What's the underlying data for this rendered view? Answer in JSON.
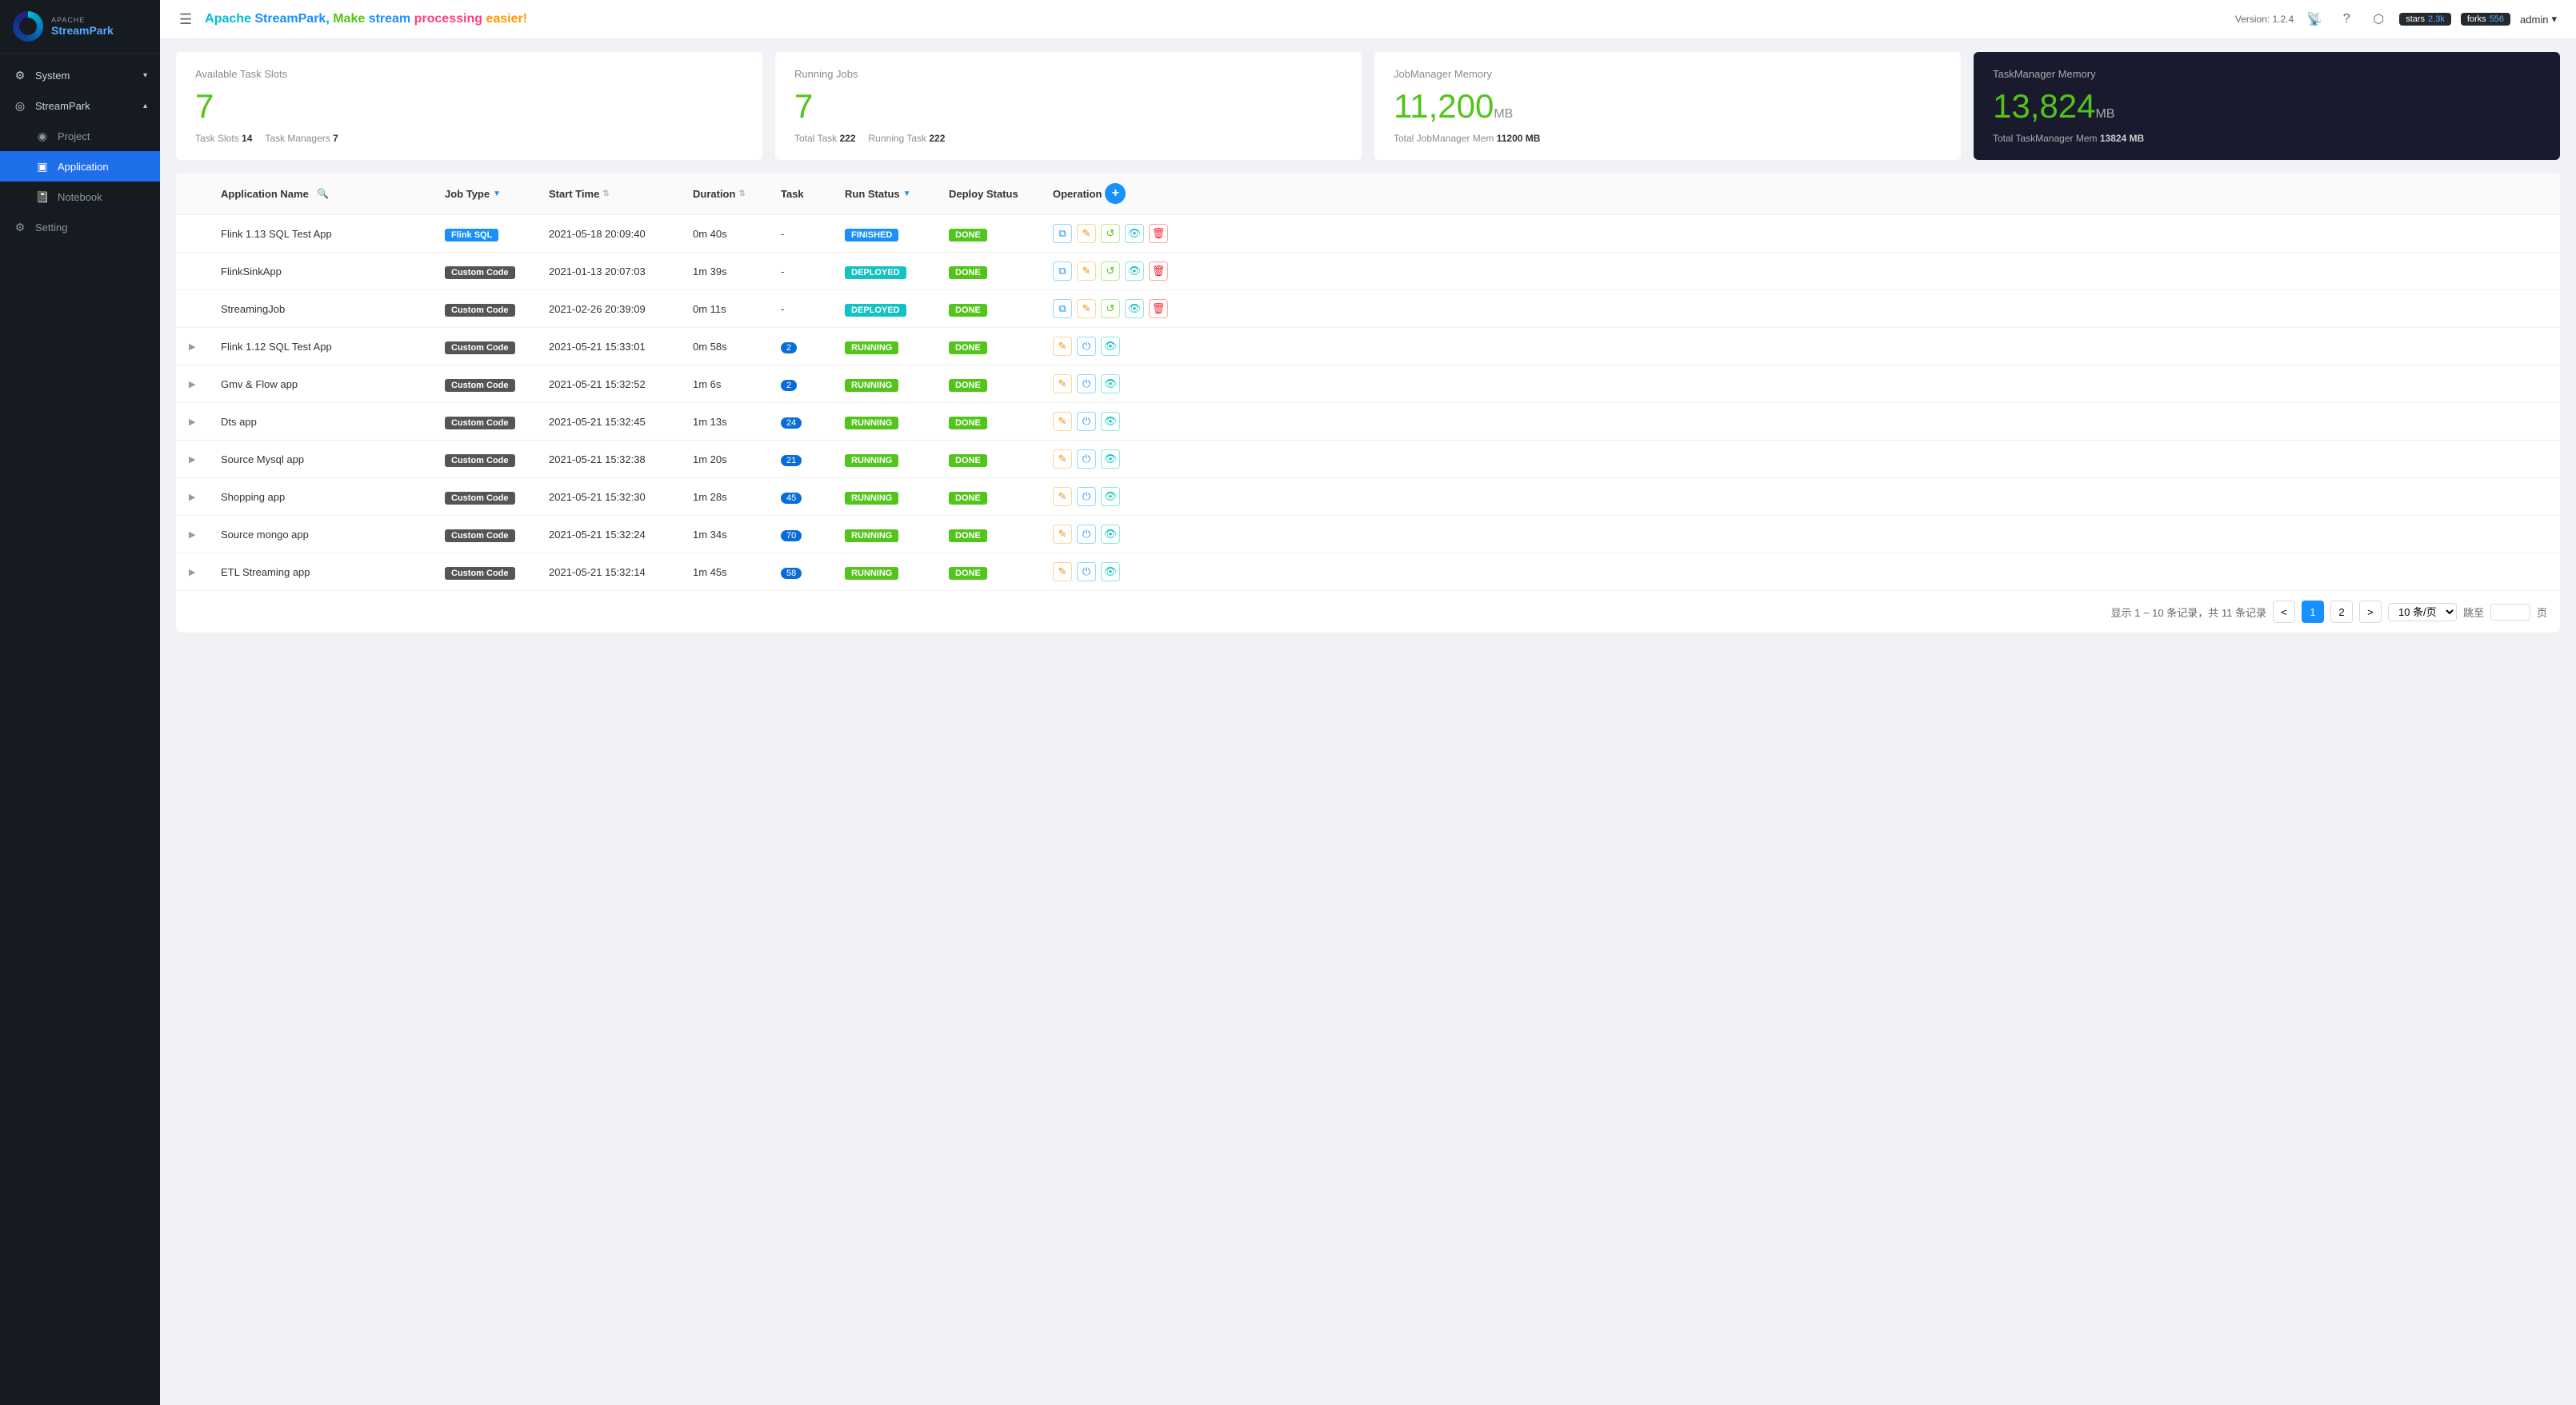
{
  "sidebar": {
    "logo": {
      "apache": "APACHE",
      "streampark": "StreamPark"
    },
    "nav": [
      {
        "id": "system",
        "label": "System",
        "icon": "⚙",
        "hasChevron": true,
        "active": false
      },
      {
        "id": "streampark",
        "label": "StreamPark",
        "icon": "◎",
        "hasChevron": true,
        "active": false,
        "expanded": true
      },
      {
        "id": "project",
        "label": "Project",
        "icon": "◉",
        "hasChevron": false,
        "active": false,
        "sub": true
      },
      {
        "id": "application",
        "label": "Application",
        "icon": "▣",
        "hasChevron": false,
        "active": true,
        "sub": true
      },
      {
        "id": "notebook",
        "label": "Notebook",
        "icon": "📓",
        "hasChevron": false,
        "active": false,
        "sub": true
      },
      {
        "id": "setting",
        "label": "Setting",
        "icon": "⚙",
        "hasChevron": false,
        "active": false
      }
    ]
  },
  "topbar": {
    "menu_icon": "☰",
    "title": {
      "apache": "Apache",
      "streampark": " StreamPark,",
      "make": " Make ",
      "stream": " stream",
      "processing": " processing ",
      "easier": " easier!"
    },
    "version": "Version: 1.2.4",
    "stars_label": "stars",
    "stars_count": "2.3k",
    "forks_label": "forks",
    "forks_count": "556",
    "admin": "admin"
  },
  "stats": [
    {
      "id": "task-slots",
      "label": "Available Task Slots",
      "value": "7",
      "footer": [
        {
          "key": "Task Slots",
          "value": "14"
        },
        {
          "key": "Task Managers",
          "value": "7"
        }
      ]
    },
    {
      "id": "running-jobs",
      "label": "Running Jobs",
      "value": "7",
      "footer": [
        {
          "key": "Total Task",
          "value": "222"
        },
        {
          "key": "Running Task",
          "value": "222"
        }
      ]
    },
    {
      "id": "jm-memory",
      "label": "JobManager Memory",
      "value": "11,200",
      "unit": "MB",
      "footer": [
        {
          "key": "Total JobManager Mem",
          "value": "11200 MB"
        }
      ]
    },
    {
      "id": "tm-memory",
      "label": "TaskManager Memory",
      "value": "13,824",
      "unit": "MB",
      "footer": [
        {
          "key": "Total TaskManager Mem",
          "value": "13824 MB"
        }
      ]
    }
  ],
  "table": {
    "columns": [
      {
        "id": "expand",
        "label": ""
      },
      {
        "id": "app-name",
        "label": "Application Name",
        "sortable": false
      },
      {
        "id": "job-type",
        "label": "Job Type",
        "filterable": true
      },
      {
        "id": "start-time",
        "label": "Start Time",
        "sortable": true
      },
      {
        "id": "duration",
        "label": "Duration",
        "sortable": true
      },
      {
        "id": "task",
        "label": "Task"
      },
      {
        "id": "run-status",
        "label": "Run Status",
        "filterable": true
      },
      {
        "id": "deploy-status",
        "label": "Deploy Status"
      },
      {
        "id": "operation",
        "label": "Operation"
      }
    ],
    "rows": [
      {
        "id": 1,
        "expandable": false,
        "app_name": "Flink 1.13 SQL Test App",
        "job_type": "Flink SQL",
        "job_type_badge": "flink-sql",
        "start_time": "2021-05-18 20:09:40",
        "duration": "0m 40s",
        "task": "-",
        "task_badge": false,
        "run_status": "FINISHED",
        "run_status_badge": "finished",
        "deploy_status": "DONE",
        "ops": [
          "copy",
          "edit",
          "restart",
          "view",
          "delete"
        ]
      },
      {
        "id": 2,
        "expandable": false,
        "app_name": "FlinkSinkApp",
        "job_type": "Custom Code",
        "job_type_badge": "custom-code",
        "start_time": "2021-01-13 20:07:03",
        "duration": "1m 39s",
        "task": "-",
        "task_badge": false,
        "run_status": "DEPLOYED",
        "run_status_badge": "deployed",
        "deploy_status": "DONE",
        "ops": [
          "copy",
          "edit",
          "restart",
          "view",
          "delete"
        ]
      },
      {
        "id": 3,
        "expandable": false,
        "app_name": "StreamingJob",
        "job_type": "Custom Code",
        "job_type_badge": "custom-code",
        "start_time": "2021-02-26 20:39:09",
        "duration": "0m 11s",
        "task": "-",
        "task_badge": false,
        "run_status": "DEPLOYED",
        "run_status_badge": "deployed",
        "deploy_status": "DONE",
        "ops": [
          "copy",
          "edit",
          "restart",
          "view",
          "delete"
        ]
      },
      {
        "id": 4,
        "expandable": true,
        "app_name": "Flink 1.12 SQL Test App",
        "job_type": "Custom Code",
        "job_type_badge": "custom-code",
        "start_time": "2021-05-21 15:33:01",
        "duration": "0m 58s",
        "task": "2",
        "task_badge": true,
        "run_status": "RUNNING",
        "run_status_badge": "running",
        "deploy_status": "DONE",
        "ops": [
          "edit",
          "power",
          "view"
        ]
      },
      {
        "id": 5,
        "expandable": true,
        "app_name": "Gmv & Flow app",
        "job_type": "Custom Code",
        "job_type_badge": "custom-code",
        "start_time": "2021-05-21 15:32:52",
        "duration": "1m 6s",
        "task": "2",
        "task_badge": true,
        "run_status": "RUNNING",
        "run_status_badge": "running",
        "deploy_status": "DONE",
        "ops": [
          "edit",
          "power",
          "view"
        ]
      },
      {
        "id": 6,
        "expandable": true,
        "app_name": "Dts app",
        "job_type": "Custom Code",
        "job_type_badge": "custom-code",
        "start_time": "2021-05-21 15:32:45",
        "duration": "1m 13s",
        "task": "24",
        "task_badge": true,
        "run_status": "RUNNING",
        "run_status_badge": "running",
        "deploy_status": "DONE",
        "ops": [
          "edit",
          "power",
          "view"
        ]
      },
      {
        "id": 7,
        "expandable": true,
        "app_name": "Source Mysql app",
        "job_type": "Custom Code",
        "job_type_badge": "custom-code",
        "start_time": "2021-05-21 15:32:38",
        "duration": "1m 20s",
        "task": "21",
        "task_badge": true,
        "run_status": "RUNNING",
        "run_status_badge": "running",
        "deploy_status": "DONE",
        "ops": [
          "edit",
          "power",
          "view"
        ]
      },
      {
        "id": 8,
        "expandable": true,
        "app_name": "Shopping app",
        "job_type": "Custom Code",
        "job_type_badge": "custom-code",
        "start_time": "2021-05-21 15:32:30",
        "duration": "1m 28s",
        "task": "45",
        "task_badge": true,
        "run_status": "RUNNING",
        "run_status_badge": "running",
        "deploy_status": "DONE",
        "ops": [
          "edit",
          "power",
          "view"
        ]
      },
      {
        "id": 9,
        "expandable": true,
        "app_name": "Source mongo app",
        "job_type": "Custom Code",
        "job_type_badge": "custom-code",
        "start_time": "2021-05-21 15:32:24",
        "duration": "1m 34s",
        "task": "70",
        "task_badge": true,
        "run_status": "RUNNING",
        "run_status_badge": "running",
        "deploy_status": "DONE",
        "ops": [
          "edit",
          "power",
          "view"
        ]
      },
      {
        "id": 10,
        "expandable": true,
        "app_name": "ETL Streaming app",
        "job_type": "Custom Code",
        "job_type_badge": "custom-code",
        "start_time": "2021-05-21 15:32:14",
        "duration": "1m 45s",
        "task": "58",
        "task_badge": true,
        "run_status": "RUNNING",
        "run_status_badge": "running",
        "deploy_status": "DONE",
        "ops": [
          "edit",
          "power",
          "view"
        ]
      }
    ]
  },
  "pagination": {
    "info": "显示 1 ~ 10 条记录，共 11 条记录",
    "prev_icon": "<",
    "page1": "1",
    "page2": "2",
    "next_icon": ">",
    "per_page_label": "10 条/页",
    "goto_label": "跳至",
    "goto_page_label": "页",
    "current_page": 1
  }
}
